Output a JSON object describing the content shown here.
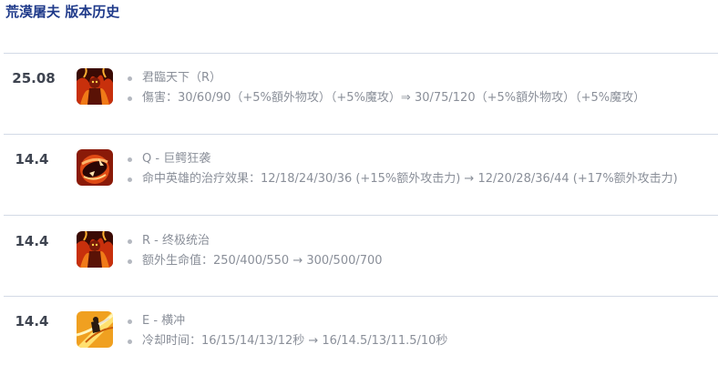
{
  "page": {
    "title": "荒漠屠夫 版本历史"
  },
  "entries": [
    {
      "version": "25.08",
      "icon": "ultimate-fire-ability-icon",
      "changes": [
        "君臨天下（R）",
        "傷害：30/60/90（+5%額外物攻）（+5%魔攻）⇒ 30/75/120（+5%額外物攻）（+5%魔攻）"
      ]
    },
    {
      "version": "14.4",
      "icon": "crocodile-rage-ability-icon",
      "changes": [
        "Q - 巨鳄狂袭",
        "命中英雄的治疗效果：12/18/24/30/36 (+15%额外攻击力) → 12/20/28/36/44 (+17%额外攻击力)"
      ]
    },
    {
      "version": "14.4",
      "icon": "ultimate-fire-ability-icon",
      "changes": [
        "R - 终极统治",
        "额外生命值：250/400/550 → 300/500/700"
      ]
    },
    {
      "version": "14.4",
      "icon": "charge-slash-ability-icon",
      "changes": [
        "E - 横冲",
        "冷却时间：16/15/14/13/12秒 → 16/14.5/13/11.5/10秒"
      ]
    }
  ],
  "colors": {
    "title": "#1f3a8a",
    "version_text": "#3e4450",
    "change_text": "#8a8f99",
    "divider": "#d3dae6"
  }
}
